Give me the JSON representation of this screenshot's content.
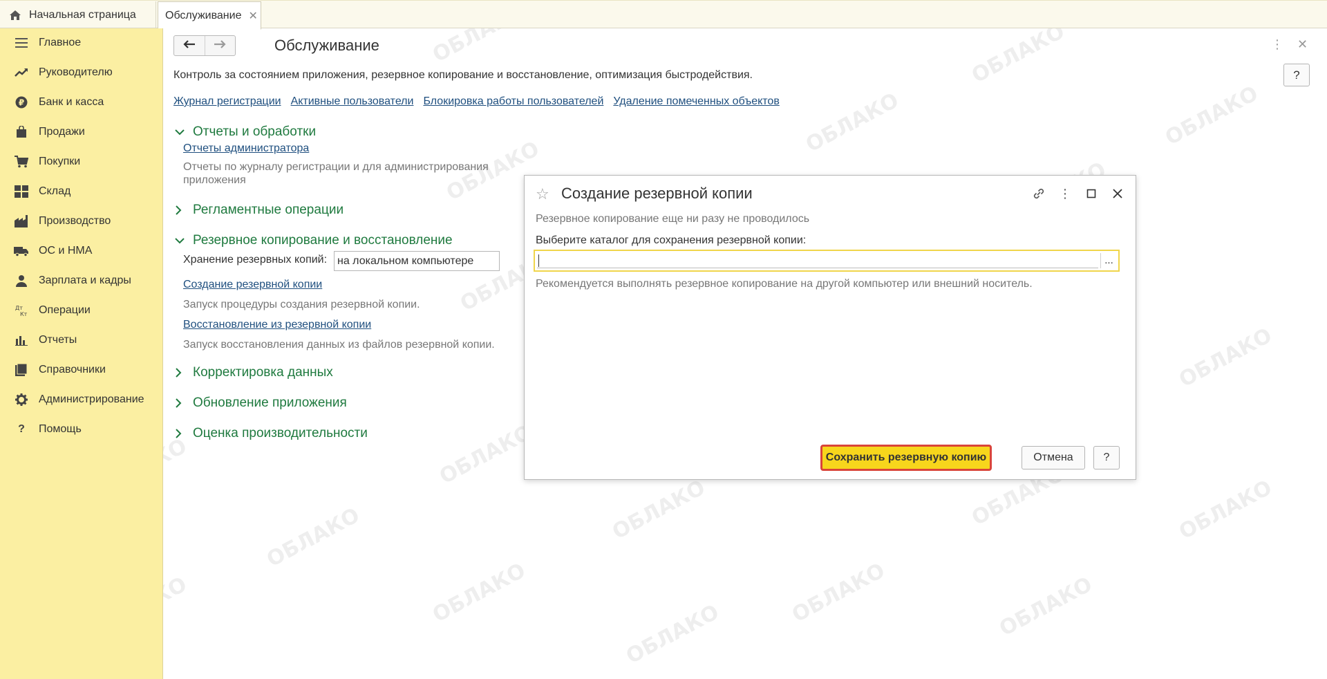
{
  "topbar": {
    "home_tab_label": "Начальная страница",
    "active_tab_label": "Обслуживание"
  },
  "sidebar": {
    "items": [
      {
        "label": "Главное",
        "icon": "menu-icon"
      },
      {
        "label": "Руководителю",
        "icon": "trend-icon"
      },
      {
        "label": "Банк и касса",
        "icon": "ruble-icon"
      },
      {
        "label": "Продажи",
        "icon": "bag-icon"
      },
      {
        "label": "Покупки",
        "icon": "cart-icon"
      },
      {
        "label": "Склад",
        "icon": "warehouse-icon"
      },
      {
        "label": "Производство",
        "icon": "factory-icon"
      },
      {
        "label": "ОС и НМА",
        "icon": "truck-icon"
      },
      {
        "label": "Зарплата и кадры",
        "icon": "person-icon"
      },
      {
        "label": "Операции",
        "icon": "dt-kt-icon"
      },
      {
        "label": "Отчеты",
        "icon": "bar-chart-icon"
      },
      {
        "label": "Справочники",
        "icon": "books-icon"
      },
      {
        "label": "Администрирование",
        "icon": "gear-icon"
      },
      {
        "label": "Помощь",
        "icon": "question-icon"
      }
    ]
  },
  "main": {
    "title": "Обслуживание",
    "description": "Контроль за состоянием приложения, резервное копирование и восстановление, оптимизация быстродействия.",
    "help_label": "?",
    "links": [
      "Журнал регистрации",
      "Активные пользователи",
      "Блокировка работы пользователей",
      "Удаление помеченных объектов"
    ],
    "sections": {
      "reports": {
        "title": "Отчеты и обработки",
        "link": "Отчеты администратора",
        "desc": "Отчеты по журналу регистрации и для администрирования приложения"
      },
      "routine": {
        "title": "Регламентные операции"
      },
      "backup": {
        "title": "Резервное копирование и восстановление",
        "storage_label": "Хранение резервных копий:",
        "storage_value": "на локальном компьютере",
        "create_link": "Создание резервной копии",
        "create_desc": "Запуск процедуры создания резервной копии.",
        "restore_link": "Восстановление из резервной копии",
        "restore_desc": "Запуск восстановления данных из файлов резервной копии."
      },
      "correction": {
        "title": "Корректировка данных"
      },
      "update": {
        "title": "Обновление приложения"
      },
      "performance": {
        "title": "Оценка производительности"
      }
    }
  },
  "dialog": {
    "title": "Создание резервной копии",
    "note": "Резервное копирование еще ни разу не проводилось",
    "dir_label": "Выберите каталог для сохранения резервной копии:",
    "dir_value": "",
    "dots_label": "...",
    "recommendation": "Рекомендуется выполнять резервное копирование на другой компьютер или внешний носитель.",
    "save_button": "Сохранить резервную копию",
    "cancel_button": "Отмена",
    "help_button": "?"
  },
  "watermark": {
    "text": "ОБЛАКО"
  },
  "colors": {
    "sidebar_bg": "#fbefa2",
    "section_green": "#1f7a3f",
    "link_blue": "#1f4f7f",
    "save_button_bg": "#f7d61c",
    "save_button_border": "#d9443a",
    "input_focus_border": "#f0d54a"
  }
}
